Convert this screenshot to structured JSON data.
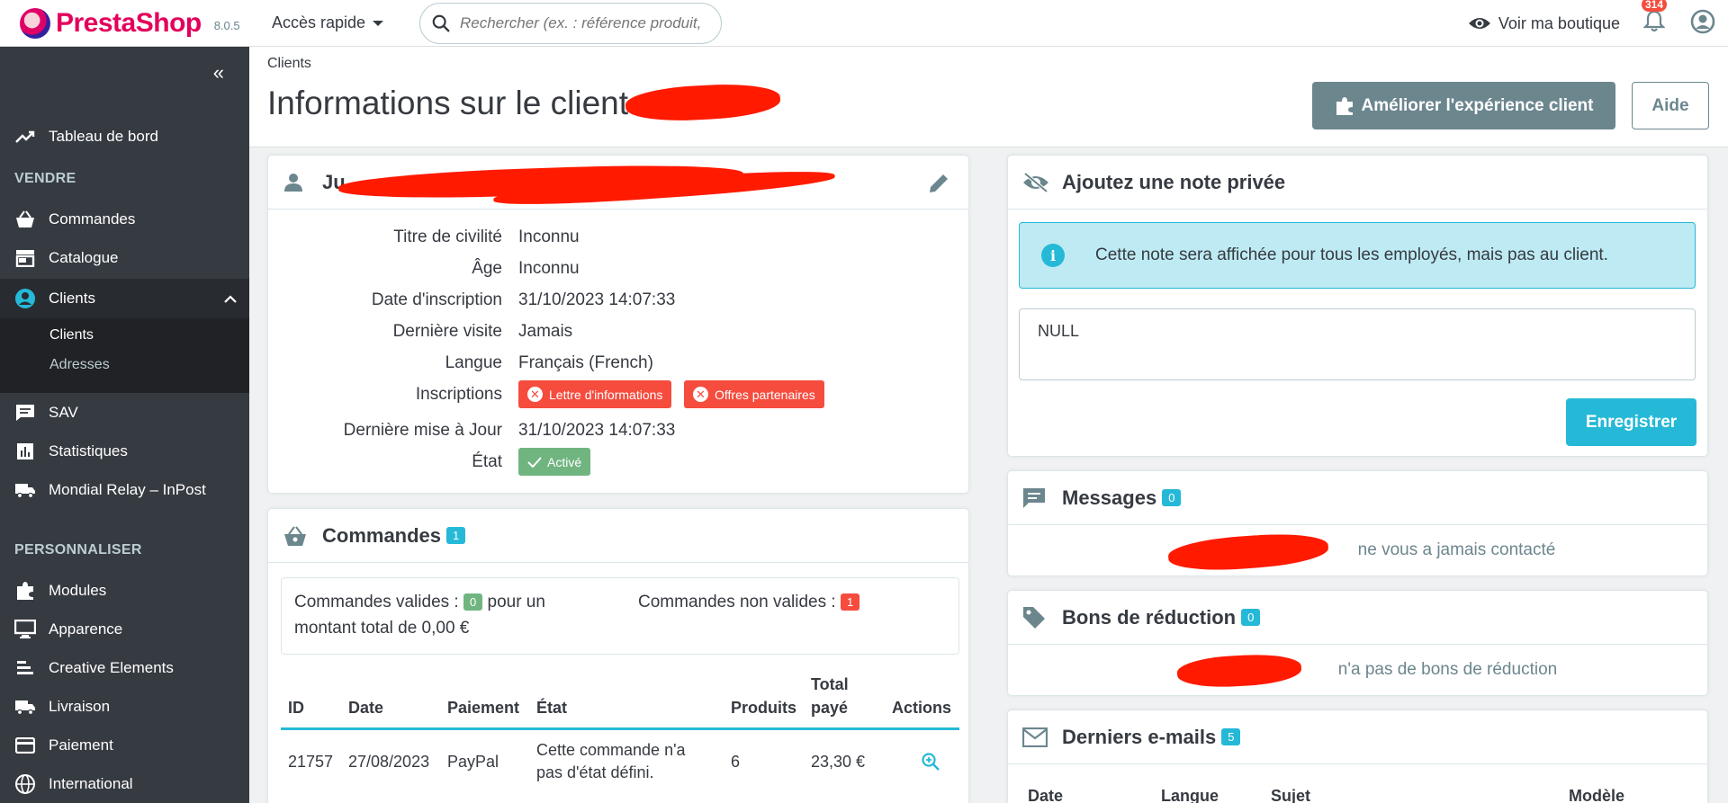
{
  "header": {
    "brand": "PrestaShop",
    "version": "8.0.5",
    "quick_access": "Accès rapide",
    "search_placeholder": "Rechercher (ex. : référence produit, no...",
    "view_shop": "Voir ma boutique",
    "notifications_count": "314"
  },
  "sidebar": {
    "dashboard": "Tableau de bord",
    "section_sell": "VENDRE",
    "orders": "Commandes",
    "catalog": "Catalogue",
    "customers": "Clients",
    "sub_customers": "Clients",
    "sub_addresses": "Adresses",
    "sav": "SAV",
    "stats": "Statistiques",
    "mondial": "Mondial Relay – InPost",
    "section_customize": "PERSONNALISER",
    "modules": "Modules",
    "design": "Apparence",
    "creative": "Creative Elements",
    "shipping": "Livraison",
    "payment": "Paiement",
    "international": "International"
  },
  "page": {
    "breadcrumb": "Clients",
    "title": "Informations sur le client",
    "btn_improve": "Améliorer l'expérience client",
    "btn_help": "Aide"
  },
  "customer": {
    "name_visible": "Ju",
    "rows": {
      "civility_label": "Titre de civilité",
      "civility_value": "Inconnu",
      "age_label": "Âge",
      "age_value": "Inconnu",
      "signup_label": "Date d'inscription",
      "signup_value": "31/10/2023 14:07:33",
      "last_visit_label": "Dernière visite",
      "last_visit_value": "Jamais",
      "language_label": "Langue",
      "language_value": "Français (French)",
      "subs_label": "Inscriptions",
      "newsletter": "Lettre d'informations",
      "partners": "Offres partenaires",
      "updated_label": "Dernière mise à Jour",
      "updated_value": "31/10/2023 14:07:33",
      "status_label": "État",
      "status_value": "Activé"
    }
  },
  "orders": {
    "title": "Commandes",
    "count": "1",
    "valid_label": "Commandes valides :",
    "valid_count": "0",
    "valid_suffix": "pour un",
    "valid_total": "montant total de 0,00 €",
    "invalid_label": "Commandes non valides :",
    "invalid_count": "1",
    "columns": {
      "id": "ID",
      "date": "Date",
      "payment": "Paiement",
      "state": "État",
      "products": "Produits",
      "total_1": "Total",
      "total_2": "payé",
      "actions": "Actions"
    },
    "rows": [
      {
        "id": "21757",
        "date": "27/08/2023",
        "payment": "PayPal",
        "state_1": "Cette commande n'a",
        "state_2": "pas d'état défini.",
        "products": "6",
        "total": "23,30 €"
      }
    ]
  },
  "private_note": {
    "title": "Ajoutez une note privée",
    "info": "Cette note sera affichée pour tous les employés, mais pas au client.",
    "value": "NULL",
    "save": "Enregistrer"
  },
  "messages": {
    "title": "Messages",
    "count": "0",
    "empty": "ne vous a jamais contacté"
  },
  "vouchers": {
    "title": "Bons de réduction",
    "count": "0",
    "empty": "n'a pas de bons de réduction"
  },
  "emails": {
    "title": "Derniers e-mails",
    "count": "5",
    "columns": {
      "date": "Date",
      "language": "Langue",
      "subject": "Sujet",
      "template": "Modèle"
    }
  },
  "colors": {
    "brand": "#e3005b",
    "sidebar": "#363a41",
    "accent": "#25b9d7",
    "danger": "#f54c3e",
    "success": "#70b580",
    "redaction": "#ff1a00"
  }
}
